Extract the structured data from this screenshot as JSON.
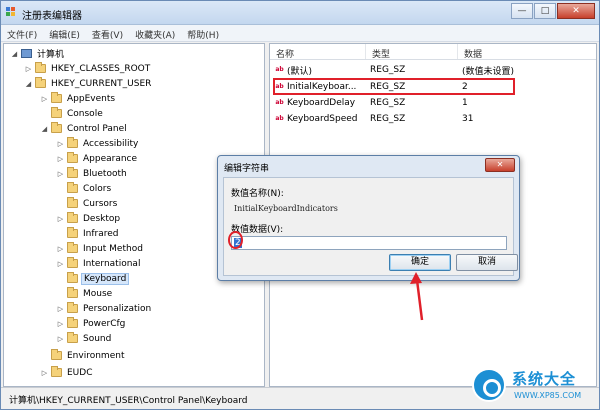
{
  "window": {
    "title": "注册表编辑器",
    "buttons": {
      "minimize": "—",
      "maximize": "□",
      "close": "✕"
    }
  },
  "menu": [
    "文件(F)",
    "编辑(E)",
    "查看(V)",
    "收藏夹(A)",
    "帮助(H)"
  ],
  "tree": {
    "root": "计算机",
    "hkcr": "HKEY_CLASSES_ROOT",
    "hkcu": "HKEY_CURRENT_USER",
    "appevents": "AppEvents",
    "console": "Console",
    "control_panel": "Control Panel",
    "children": [
      "Accessibility",
      "Appearance",
      "Bluetooth",
      "Colors",
      "Cursors",
      "Desktop",
      "Infrared",
      "Input Method",
      "International",
      "Keyboard",
      "Mouse",
      "Personalization",
      "PowerCfg",
      "Sound"
    ],
    "environment": "Environment",
    "eudc": "EUDC"
  },
  "list": {
    "headers": {
      "name": "名称",
      "type": "类型",
      "data": "数据"
    },
    "rows": [
      {
        "name": "(默认)",
        "type": "REG_SZ",
        "data": "(数值未设置)"
      },
      {
        "name": "InitialKeyboar...",
        "type": "REG_SZ",
        "data": "2"
      },
      {
        "name": "KeyboardDelay",
        "type": "REG_SZ",
        "data": "1"
      },
      {
        "name": "KeyboardSpeed",
        "type": "REG_SZ",
        "data": "31"
      }
    ]
  },
  "dialog": {
    "title": "编辑字符串",
    "close": "✕",
    "name_label": "数值名称(N):",
    "name_value": "InitialKeyboardIndicators",
    "data_label": "数值数据(V):",
    "data_value": "2",
    "ok": "确定",
    "cancel": "取消"
  },
  "status": {
    "path": "计算机\\HKEY_CURRENT_USER\\Control Panel\\Keyboard"
  },
  "watermark": {
    "text": "系统大全",
    "url": "WWW.XP85.COM"
  },
  "colors": {
    "highlight_red": "#e0202a",
    "selection_blue": "#3271d1",
    "watermark_blue": "#1c8fd4"
  }
}
